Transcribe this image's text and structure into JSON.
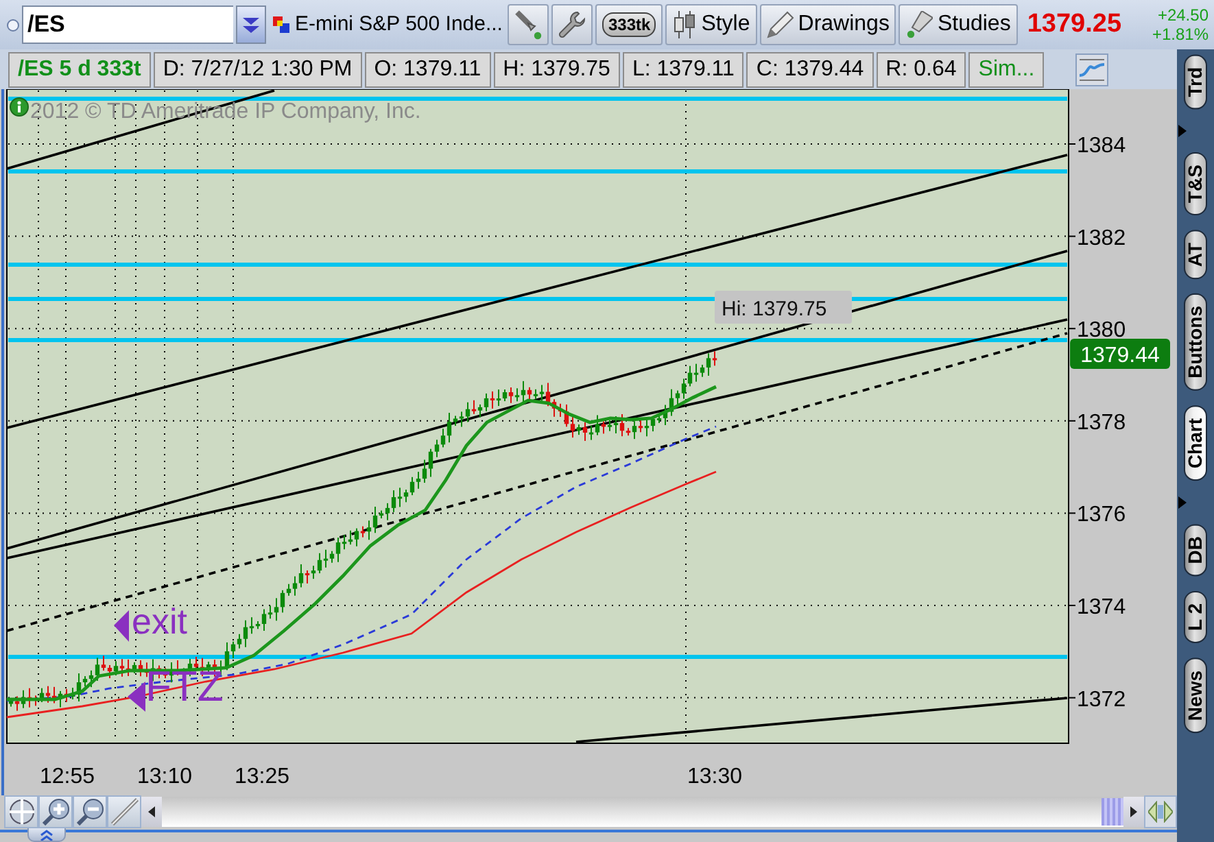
{
  "toolbar": {
    "symbol": "/ES",
    "description": "E-mini S&P 500 Inde...",
    "buttons": [
      {
        "label": "333tk"
      },
      {
        "label": "Style"
      },
      {
        "label": "Drawings"
      },
      {
        "label": "Studies"
      }
    ],
    "last_price": "1379.25",
    "net_change": "+24.50",
    "percent_change": "+1.81%"
  },
  "info_bar": {
    "chart_label": "/ES 5 d 333t",
    "fields": [
      "D: 7/27/12 1:30 PM",
      "O: 1379.11",
      "H: 1379.75",
      "L: 1379.11",
      "C: 1379.44",
      "R: 0.64"
    ],
    "mode": "Sim..."
  },
  "chart": {
    "copyright": "2012 © TD Ameritrade IP Company, Inc.",
    "price_labels": [
      "1384",
      "1382",
      "1380",
      "1378",
      "1376",
      "1374",
      "1372"
    ],
    "time_labels": [
      "12:55",
      "13:10",
      "13:25",
      "13:30"
    ],
    "current_price": "1379.44",
    "high_label": "Hi: 1379.75",
    "annotations": [
      "exit",
      "FTZ"
    ]
  },
  "side_tabs": [
    {
      "label": "Trd",
      "selected": false
    },
    {
      "label": "T&S",
      "selected": false
    },
    {
      "label": "AT",
      "selected": false
    },
    {
      "label": "Buttons",
      "selected": false
    },
    {
      "label": "Chart",
      "selected": true
    },
    {
      "label": "DB",
      "selected": false
    },
    {
      "label": "L 2",
      "selected": false
    },
    {
      "label": "News",
      "selected": false
    }
  ]
}
